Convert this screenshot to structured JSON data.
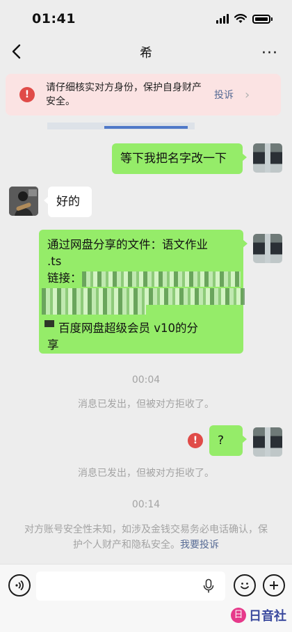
{
  "status_bar": {
    "time": "01:41"
  },
  "header": {
    "title": "希",
    "more": "···"
  },
  "banner": {
    "text": "请仔细核实对方身份，保护自身财产安全。",
    "action": "投诉"
  },
  "messages": {
    "m1": "等下我把名字改一下",
    "m2": "好的",
    "m3": {
      "line1": "通过网盘分享的文件：语文作业",
      "line2": ".ts",
      "line3": "链接：",
      "line5": "百度网盘超级会员 v10的分",
      "line6": "享"
    },
    "m4": "?"
  },
  "time_stamps": {
    "t1": "00:04",
    "t2": "00:14"
  },
  "system": {
    "rejected_1": "消息已发出，但被对方拒收了。",
    "rejected_2": "消息已发出，但被对方拒收了。",
    "safety_text": "对方账号安全性未知，如涉及金钱交易务必电话确认，保护个人财产和隐私安全。",
    "safety_link": "我要投诉"
  },
  "watermark": {
    "logo": "日",
    "text": "日音社"
  },
  "colors": {
    "bubble_green": "#95ec69",
    "alert_red": "#e04b48",
    "link_blue": "#576b95",
    "banner_bg": "#fbe3e3"
  },
  "icons": [
    "back-arrow",
    "more-dots",
    "alert",
    "chevron-right",
    "voice",
    "mic",
    "emoji",
    "plus"
  ]
}
